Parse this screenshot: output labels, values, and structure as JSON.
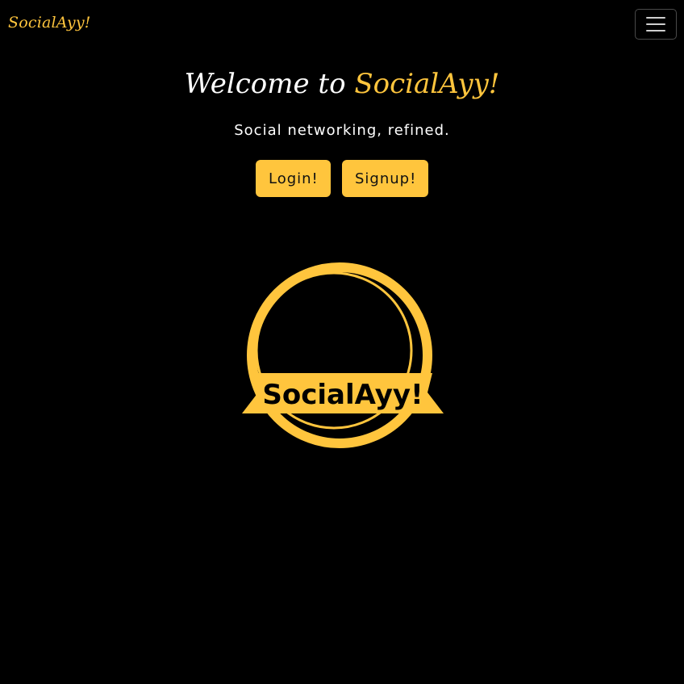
{
  "navbar": {
    "brand": "SocialAyy!",
    "toggler_icon": "hamburger-menu-icon"
  },
  "hero": {
    "title_prefix": "Welcome to ",
    "title_brand": "SocialAyy!",
    "tagline": "Social networking, refined."
  },
  "buttons": {
    "login_label": "Login!",
    "signup_label": "Signup!"
  },
  "logo": {
    "text": "SocialAyy!"
  },
  "colors": {
    "background": "#000000",
    "accent": "#ffc53d",
    "text": "#ffffff"
  }
}
